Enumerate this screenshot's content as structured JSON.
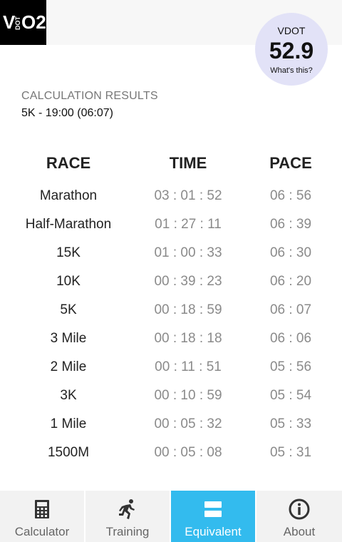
{
  "app": {
    "logo_v": "V",
    "logo_dot": "DOT",
    "logo_o2": "O2"
  },
  "vdot": {
    "label": "VDOT",
    "value": "52.9",
    "link": "What's this?"
  },
  "results": {
    "title": "CALCULATION RESULTS",
    "subtitle": "5K - 19:00 (06:07)"
  },
  "table": {
    "headers": {
      "race": "RACE",
      "time": "TIME",
      "pace": "PACE"
    },
    "rows": [
      {
        "race": "Marathon",
        "time": "03 : 01 : 52",
        "pace": "06 : 56"
      },
      {
        "race": "Half-Marathon",
        "time": "01 : 27 : 11",
        "pace": "06 : 39"
      },
      {
        "race": "15K",
        "time": "01 : 00 : 33",
        "pace": "06 : 30"
      },
      {
        "race": "10K",
        "time": "00 : 39 : 23",
        "pace": "06 : 20"
      },
      {
        "race": "5K",
        "time": "00 : 18 : 59",
        "pace": "06 : 07"
      },
      {
        "race": "3 Mile",
        "time": "00 : 18 : 18",
        "pace": "06 : 06"
      },
      {
        "race": "2 Mile",
        "time": "00 : 11 : 51",
        "pace": "05 : 56"
      },
      {
        "race": "3K",
        "time": "00 : 10 : 59",
        "pace": "05 : 54"
      },
      {
        "race": "1 Mile",
        "time": "00 : 05 : 32",
        "pace": "05 : 33"
      },
      {
        "race": "1500M",
        "time": "00 : 05 : 08",
        "pace": "05 : 31"
      }
    ]
  },
  "tabs": [
    {
      "label": "Calculator",
      "icon": "calculator-icon",
      "active": false
    },
    {
      "label": "Training",
      "icon": "runner-icon",
      "active": false
    },
    {
      "label": "Equivalent",
      "icon": "equivalent-icon",
      "active": true
    },
    {
      "label": "About",
      "icon": "info-icon",
      "active": false
    }
  ],
  "colors": {
    "accent": "#33bbee",
    "badge": "#e2e2f7",
    "muted": "#8a8a8a"
  }
}
